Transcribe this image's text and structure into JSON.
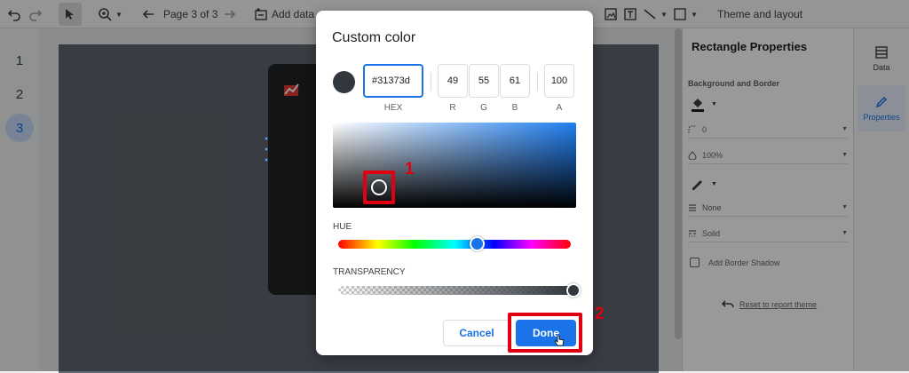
{
  "toolbar": {
    "page_indicator": "Page 3 of 3",
    "add_data_label": "Add data",
    "theme_label": "Theme and layout"
  },
  "pages": [
    "1",
    "2",
    "3"
  ],
  "properties_panel": {
    "title": "Rectangle Properties",
    "section": "Background and Border",
    "border_radius": "0",
    "opacity": "100%",
    "border_weight": "None",
    "border_style": "Solid",
    "shadow_label": "Add Border Shadow",
    "reset_label": "Reset to report theme"
  },
  "rail": {
    "data_label": "Data",
    "properties_label": "Properties"
  },
  "dialog": {
    "title": "Custom color",
    "hex_value": "#31373d",
    "r_value": "49",
    "g_value": "55",
    "b_value": "61",
    "a_value": "100",
    "hex_label": "HEX",
    "r_label": "R",
    "g_label": "G",
    "b_label": "B",
    "a_label": "A",
    "hue_label": "HUE",
    "transparency_label": "TRANSPARENCY",
    "cancel_label": "Cancel",
    "done_label": "Done",
    "selected_color": "#31373d"
  },
  "annotations": {
    "step1": "1",
    "step2": "2"
  },
  "colors": {
    "accent": "#1a73e8",
    "annotation": "#e00012"
  }
}
